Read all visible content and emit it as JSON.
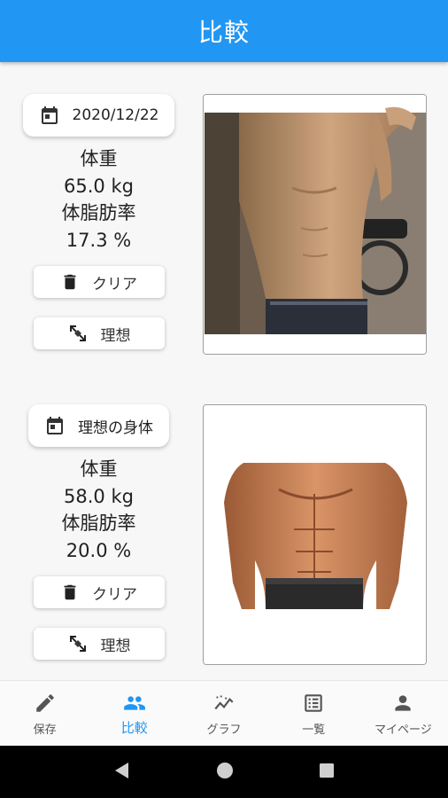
{
  "appbar": {
    "title": "比較"
  },
  "current": {
    "date_label": "2020/12/22",
    "weight_label": "体重",
    "weight_value": "65.0 kg",
    "fat_label": "体脂肪率",
    "fat_value": "17.3 %",
    "clear_label": "クリア",
    "ideal_label": "理想"
  },
  "ideal": {
    "chip_label": "理想の身体",
    "weight_label": "体重",
    "weight_value": "58.0 kg",
    "fat_label": "体脂肪率",
    "fat_value": "20.0 %",
    "clear_label": "クリア",
    "ideal_label": "理想"
  },
  "nav": {
    "items": [
      {
        "label": "保存",
        "icon": "pencil-icon"
      },
      {
        "label": "比較",
        "icon": "people-icon",
        "active": true
      },
      {
        "label": "グラフ",
        "icon": "chart-icon"
      },
      {
        "label": "一覧",
        "icon": "list-icon"
      },
      {
        "label": "マイページ",
        "icon": "person-icon"
      }
    ]
  },
  "colors": {
    "accent": "#2196f3",
    "icon": "#555555",
    "system_bar": "#000000"
  }
}
